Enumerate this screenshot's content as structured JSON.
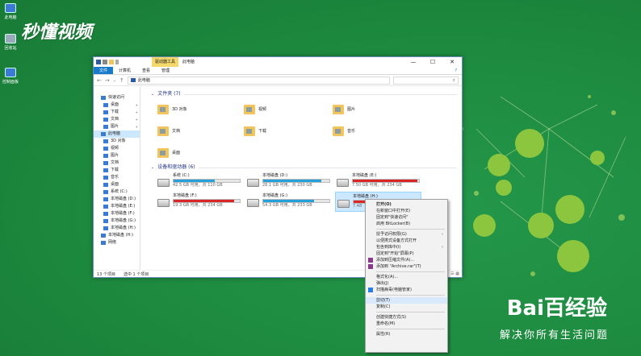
{
  "watermark": "秒懂视频",
  "desktop_icons": [
    "此电脑",
    "回收站",
    "控制面板"
  ],
  "branding": {
    "logo": "Bai百经验",
    "tagline": "解决你所有生活问题"
  },
  "window": {
    "context_tab": "驱动器工具",
    "title": "此电脑",
    "controls": [
      "—",
      "☐",
      "✕"
    ],
    "ribbon_tabs": [
      "文件",
      "计算机",
      "查看",
      "管理"
    ],
    "help_icon": "?",
    "address": "此电脑",
    "search_glyph": "⌕"
  },
  "nav_pane": {
    "items": [
      {
        "label": "快速访问",
        "icon": "star-icon",
        "level": 0,
        "pinned": false
      },
      {
        "label": "桌面",
        "icon": "desktop-icon",
        "level": 1,
        "pinned": true
      },
      {
        "label": "下载",
        "icon": "download-icon",
        "level": 1,
        "pinned": true
      },
      {
        "label": "文档",
        "icon": "document-icon",
        "level": 1,
        "pinned": true
      },
      {
        "label": "图片",
        "icon": "picture-icon",
        "level": 1,
        "pinned": true
      },
      {
        "label": "此电脑",
        "icon": "computer-icon",
        "level": 0,
        "pinned": false
      },
      {
        "label": "3D 对象",
        "icon": "3d-icon",
        "level": 1,
        "pinned": false
      },
      {
        "label": "视频",
        "icon": "video-icon",
        "level": 1,
        "pinned": false
      },
      {
        "label": "图片",
        "icon": "picture-icon",
        "level": 1,
        "pinned": false
      },
      {
        "label": "文档",
        "icon": "document-icon",
        "level": 1,
        "pinned": false
      },
      {
        "label": "下载",
        "icon": "download-icon",
        "level": 1,
        "pinned": false
      },
      {
        "label": "音乐",
        "icon": "music-icon",
        "level": 1,
        "pinned": false
      },
      {
        "label": "桌面",
        "icon": "desktop-icon",
        "level": 1,
        "pinned": false
      },
      {
        "label": "系统 (C:)",
        "icon": "drive-icon",
        "level": 1,
        "pinned": false
      },
      {
        "label": "本地磁盘 (D:)",
        "icon": "drive-icon",
        "level": 1,
        "pinned": false
      },
      {
        "label": "本地磁盘 (E:)",
        "icon": "drive-icon",
        "level": 1,
        "pinned": false
      },
      {
        "label": "本地磁盘 (F:)",
        "icon": "drive-icon",
        "level": 1,
        "pinned": false
      },
      {
        "label": "本地磁盘 (G:)",
        "icon": "drive-icon",
        "level": 1,
        "pinned": false
      },
      {
        "label": "本地磁盘 (H:)",
        "icon": "drive-icon",
        "level": 1,
        "pinned": false
      },
      {
        "label": "本地磁盘 (H:)",
        "icon": "drive-icon",
        "level": 0,
        "pinned": false
      },
      {
        "label": "网络",
        "icon": "network-icon",
        "level": 0,
        "pinned": false
      }
    ]
  },
  "folders_group": "文件夹 (7)",
  "folders": [
    "3D 对象",
    "视频",
    "图片",
    "文档",
    "下载",
    "音乐",
    "桌面"
  ],
  "drives_group": "设备和驱动器 (6)",
  "drives": [
    {
      "name": "系统 (C:)",
      "free": "42.5 GB 可用，共 110 GB",
      "used": 0.62,
      "color": "#26a0da"
    },
    {
      "name": "本地磁盘 (D:)",
      "free": "28.1 GB 可用，共 230 GB",
      "used": 0.88,
      "color": "#26a0da"
    },
    {
      "name": "本地磁盘 (E:)",
      "free": "7.50 GB 可用，共 234 GB",
      "used": 0.97,
      "color": "#da2626"
    },
    {
      "name": "本地磁盘 (F:)",
      "free": "19.3 GB 可用，共 234 GB",
      "used": 0.92,
      "color": "#da2626"
    },
    {
      "name": "本地磁盘 (G:)",
      "free": "54.3 GB 可用，共 233 GB",
      "used": 0.77,
      "color": "#26a0da"
    },
    {
      "name": "本地磁盘 (H:)",
      "free": "7.48",
      "used": 0.97,
      "color": "#da2626"
    }
  ],
  "status": {
    "count": "13 个项目",
    "selected": "选中 1 个项目"
  },
  "context_menu": [
    {
      "label": "打开(O)",
      "bold": true
    },
    {
      "label": "在新窗口中打开(E)"
    },
    {
      "label": "固定到\"快速访问\""
    },
    {
      "label": "启用 BitLocker(B)"
    },
    {
      "sep": true
    },
    {
      "label": "授予访问权限(G)",
      "arrow": true
    },
    {
      "label": "以便携式设备方式打开"
    },
    {
      "label": "包含到库中(I)",
      "arrow": true
    },
    {
      "label": "固定到\"开始\"屏幕(P)"
    },
    {
      "label": "添加到压缩文件(A)...",
      "icon": "rar-icon"
    },
    {
      "label": "添加到 \"Archive.rar\"(T)",
      "icon": "rar-icon"
    },
    {
      "sep": true
    },
    {
      "label": "格式化(A)..."
    },
    {
      "label": "弹出(J)"
    },
    {
      "label": "扫描病毒(电脑管家)",
      "icon": "shield-icon"
    },
    {
      "sep": true
    },
    {
      "label": "剪切(T)",
      "hl": true
    },
    {
      "label": "复制(C)"
    },
    {
      "sep": true
    },
    {
      "label": "创建快捷方式(S)"
    },
    {
      "label": "重命名(M)"
    },
    {
      "sep": true
    },
    {
      "label": "属性(R)"
    }
  ]
}
